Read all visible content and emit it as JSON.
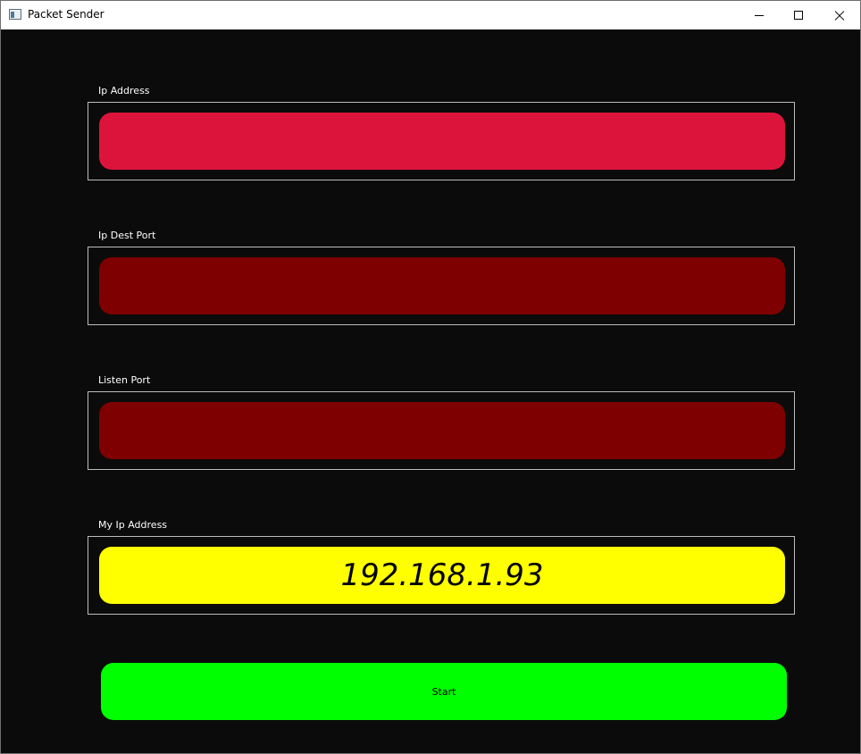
{
  "window": {
    "title": "Packet Sender",
    "controls": [
      "minimize-icon",
      "maximize-icon",
      "close-icon"
    ]
  },
  "fields": {
    "ip_address": {
      "label": "Ip Address",
      "value": "",
      "color": "#dc143c"
    },
    "ip_dest_port": {
      "label": "Ip Dest Port",
      "value": "",
      "color": "#7f0000"
    },
    "listen_port": {
      "label": "Listen Port",
      "value": "",
      "color": "#7f0000"
    },
    "my_ip_address": {
      "label": "My Ip Address",
      "value": "192.168.1.93",
      "color": "#ffff00"
    }
  },
  "start_button": {
    "label": "Start",
    "color": "#00ff00"
  },
  "colors": {
    "background": "#0b0b0b",
    "frame_border": "#bdbdbd",
    "label_text": "#ffffff"
  }
}
